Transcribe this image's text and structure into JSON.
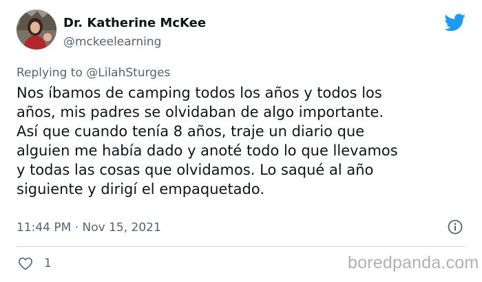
{
  "author": {
    "name": "Dr. Katherine McKee",
    "handle": "@mckeelearning"
  },
  "reply": {
    "prefix": "Replying to",
    "to": "@LilahSturges"
  },
  "tweet": {
    "lines": [
      "Nos íbamos de camping todos los años y todos los",
      "años, mis padres se olvidaban de algo importante.",
      "Así que cuando tenía 8 años, traje un diario que",
      "alguien me había dado y anoté todo lo que llevamos",
      "y todas las cosas que olvidamos. Lo saqué al año",
      "siguiente y dirigí el empaquetado."
    ],
    "timestamp": "11:44 PM · Nov 15, 2021",
    "likes": "1"
  },
  "icons": {
    "brand": "twitter-bird-icon",
    "info": "info-icon",
    "like": "heart-icon"
  },
  "colors": {
    "twitter_blue": "#1d9bf0",
    "text_primary": "#0f1419",
    "text_secondary": "#536471",
    "divider": "#cfd9de",
    "watermark": "#b0b0b0"
  },
  "watermark": "boredpanda.com"
}
